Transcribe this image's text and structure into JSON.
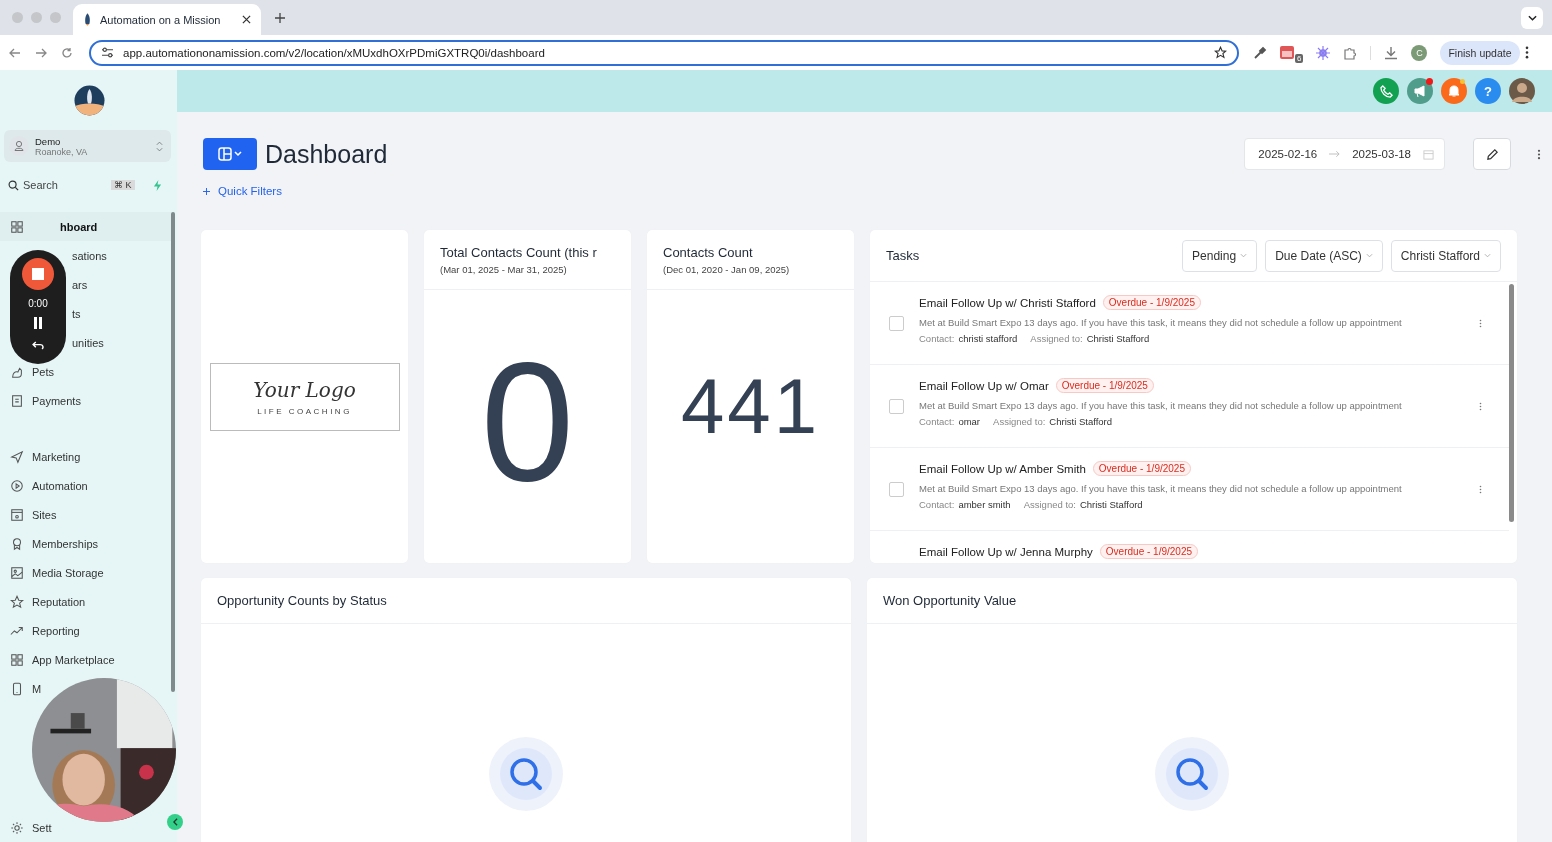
{
  "browser": {
    "tab_title": "Automation on a Mission",
    "url": "app.automationonamission.com/v2/location/xMUxdhOXrPDmiGXTRQ0i/dashboard",
    "extension_badge": "6",
    "profile_initial": "C",
    "update_button": "Finish update"
  },
  "sidebar": {
    "account": {
      "name": "Demo",
      "location": "Roanoke, VA"
    },
    "search": {
      "placeholder": "Search",
      "shortcut": "⌘ K"
    },
    "groups": [
      [
        {
          "label": "hboard",
          "kind": "partial",
          "selected": true
        },
        {
          "label": "sations",
          "kind": "partial",
          "selected": false
        },
        {
          "label": "ars",
          "kind": "partial",
          "selected": false
        },
        {
          "label": "ts",
          "kind": "partial",
          "selected": false
        },
        {
          "label": "unities",
          "kind": "partial",
          "selected": false
        },
        {
          "label": "Pets",
          "kind": "full",
          "selected": false
        },
        {
          "label": "Payments",
          "kind": "full",
          "selected": false
        }
      ],
      [
        {
          "label": "Marketing",
          "kind": "full",
          "selected": false
        },
        {
          "label": "Automation",
          "kind": "full",
          "selected": false
        },
        {
          "label": "Sites",
          "kind": "full",
          "selected": false
        },
        {
          "label": "Memberships",
          "kind": "full",
          "selected": false
        },
        {
          "label": "Media Storage",
          "kind": "full",
          "selected": false
        },
        {
          "label": "Reputation",
          "kind": "full",
          "selected": false
        },
        {
          "label": "Reporting",
          "kind": "full",
          "selected": false
        },
        {
          "label": "App Marketplace",
          "kind": "full",
          "selected": false
        },
        {
          "label": "M",
          "kind": "full",
          "selected": false
        },
        {
          "label": "Sett",
          "kind": "full",
          "selected": false
        }
      ]
    ]
  },
  "recorder": {
    "time": "0:00"
  },
  "header": {
    "help": "?"
  },
  "page": {
    "title": "Dashboard",
    "quick_filters": "Quick Filters",
    "date_from": "2025-02-16",
    "date_to": "2025-03-18"
  },
  "logo_card": {
    "script": "Your Logo",
    "tagline": "LIFE COACHING"
  },
  "stat_cards": [
    {
      "title": "Total Contacts Count (this r",
      "range": "(Mar 01, 2025 - Mar 31, 2025)",
      "value": "0"
    },
    {
      "title": "Contacts Count",
      "range": "(Dec 01, 2020 - Jan 09, 2025)",
      "value": "441"
    }
  ],
  "tasks": {
    "title": "Tasks",
    "filters": [
      "Pending",
      "Due Date (ASC)",
      "Christi Stafford"
    ],
    "rows": [
      {
        "title": "Email Follow Up w/ Christi Stafford",
        "badge": "Overdue - 1/9/2025",
        "description": "Met at Build Smart Expo 13 days ago. If you have this task, it means they did not schedule a follow up appointment",
        "contact_label": "Contact:",
        "contact": "christi stafford",
        "assigned_label": "Assigned to:",
        "assigned": "Christi Stafford",
        "checked": false
      },
      {
        "title": "Email Follow Up w/ Omar",
        "badge": "Overdue - 1/9/2025",
        "description": "Met at Build Smart Expo 13 days ago. If you have this task, it means they did not schedule a follow up appointment",
        "contact_label": "Contact:",
        "contact": "omar",
        "assigned_label": "Assigned to:",
        "assigned": "Christi Stafford",
        "checked": false
      },
      {
        "title": "Email Follow Up w/ Amber Smith",
        "badge": "Overdue - 1/9/2025",
        "description": "Met at Build Smart Expo 13 days ago. If you have this task, it means they did not schedule a follow up appointment",
        "contact_label": "Contact:",
        "contact": "amber smith",
        "assigned_label": "Assigned to:",
        "assigned": "Christi Stafford",
        "checked": false
      },
      {
        "title": "Email Follow Up w/ Jenna Murphy",
        "badge": "Overdue - 1/9/2025"
      }
    ]
  },
  "chart_cards": [
    {
      "title": "Opportunity Counts by Status"
    },
    {
      "title": "Won Opportunity Value"
    }
  ]
}
